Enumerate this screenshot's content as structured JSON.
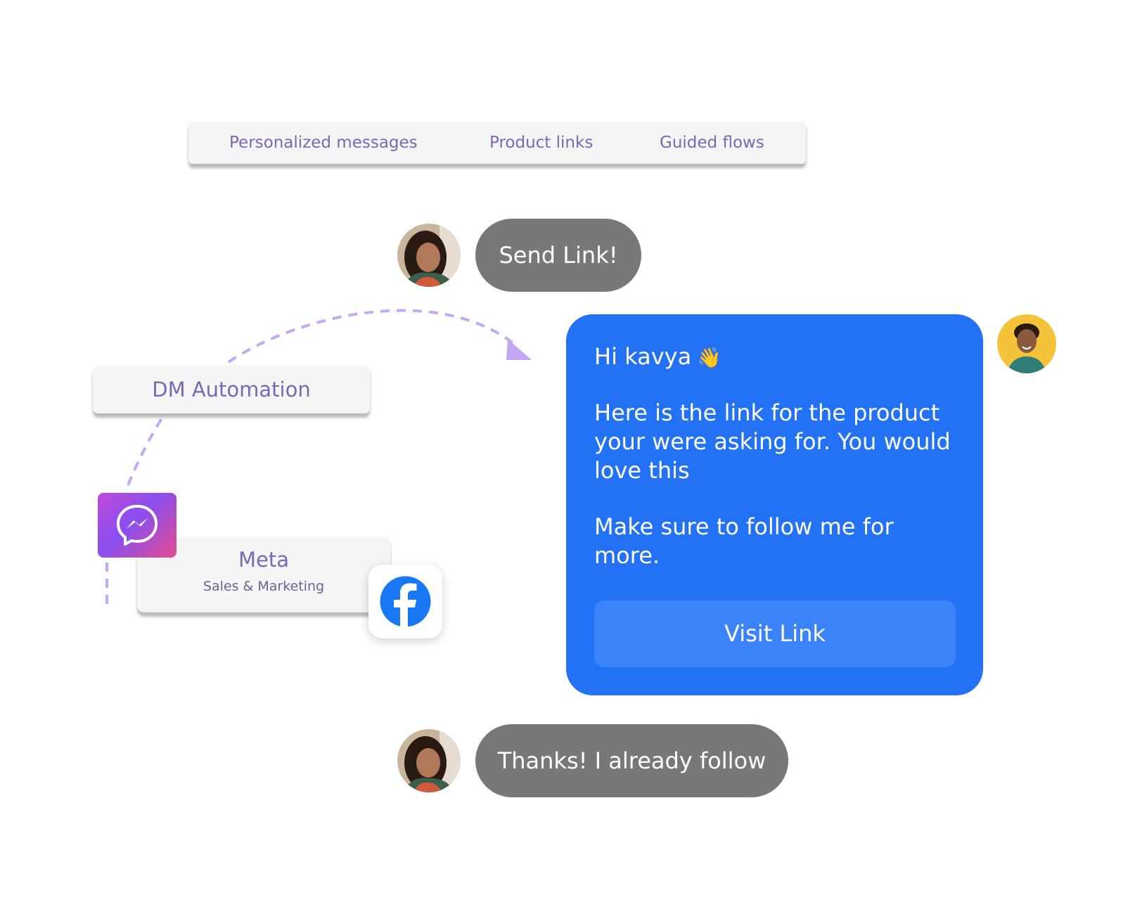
{
  "feature_tabs": [
    "Personalized messages",
    "Product links",
    "Guided flows"
  ],
  "flow": {
    "dm_automation_label": "DM Automation",
    "connector_color": "#c4a8f5"
  },
  "integration": {
    "title": "Meta",
    "subtitle": "Sales & Marketing",
    "icons": [
      "messenger-icon",
      "facebook-icon"
    ]
  },
  "chat": {
    "customer_message_1": "Send Link!",
    "reply": {
      "greeting": "Hi kavya",
      "wave_emoji": "👋",
      "body": "Here is the link for the product your were asking for. You would love this",
      "follow_line": "Make sure to follow me for more.",
      "button_label": "Visit Link"
    },
    "customer_message_2": "Thanks! I already follow"
  },
  "colors": {
    "accent_purple": "#7a68b5",
    "reply_blue": "#2371f4",
    "button_blue": "#3a83f8",
    "customer_bubble_grey": "#787878",
    "sender_avatar_bg": "#f4c33a",
    "facebook_blue": "#1877f2"
  }
}
